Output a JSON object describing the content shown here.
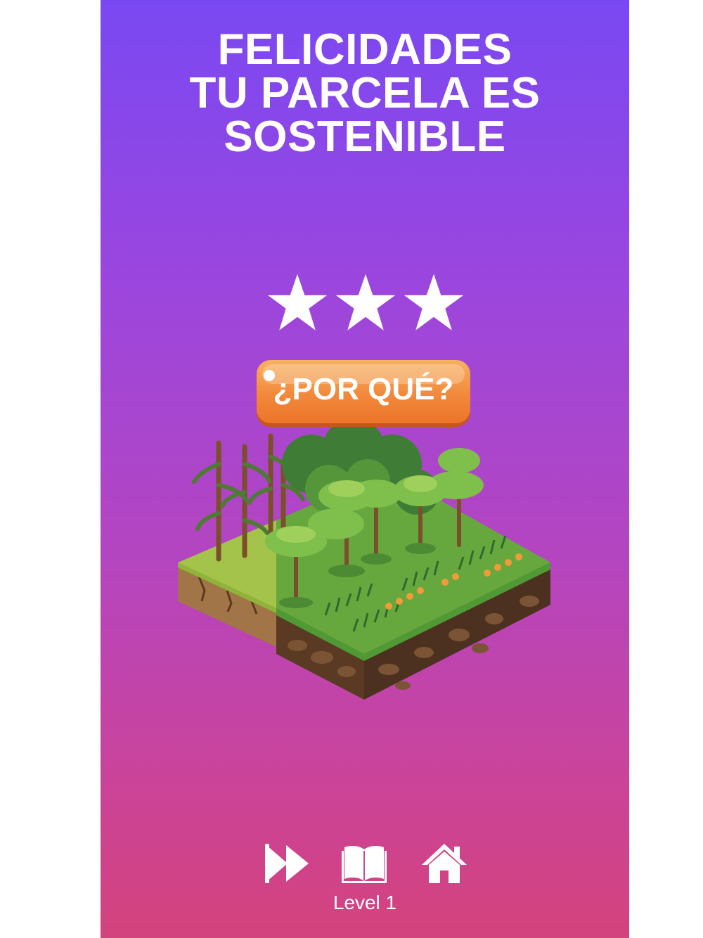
{
  "result": {
    "title_lines": [
      "FELICIDADES",
      "TU PARCELA ES",
      "SOSTENIBLE"
    ],
    "stars_earned": 3,
    "stars_total": 3
  },
  "why_button": {
    "label": "¿POR QUÉ?"
  },
  "illustration": {
    "name": "isometric-sustainable-plot"
  },
  "controls": {
    "next_icon": "fast-forward-icon",
    "book_icon": "open-book-icon",
    "home_icon": "home-icon"
  },
  "level_label": "Level 1",
  "colors": {
    "gradient_top": "#7a48f2",
    "gradient_bottom": "#d3437c",
    "button_orange": "#f2893c",
    "text": "#ffffff"
  }
}
